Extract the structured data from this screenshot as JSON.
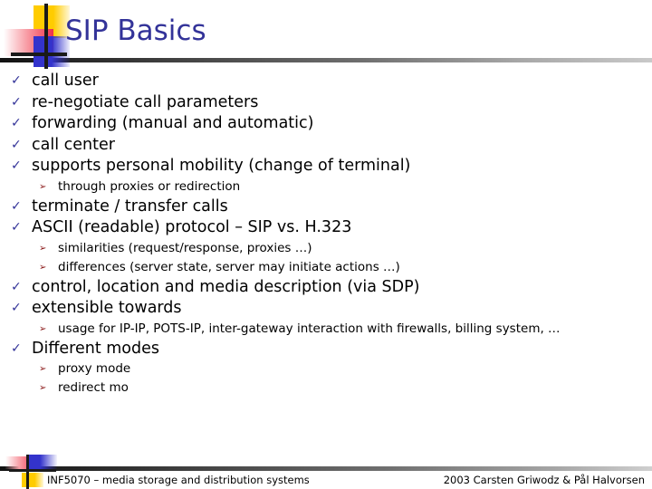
{
  "slide": {
    "title": "SIP Basics",
    "title_color": "#333399",
    "bullet_marker_level1": "✓",
    "bullet_marker_level1_name": "check-mark-icon",
    "bullet_marker_level1_color": "#333399",
    "bullet_marker_level2": "➢",
    "bullet_marker_level2_name": "arrowhead-bullet-icon",
    "bullet_marker_level2_color": "#8b1a1a",
    "items": [
      {
        "text": "call user",
        "subitems": []
      },
      {
        "text": "re-negotiate call parameters",
        "subitems": []
      },
      {
        "text": "forwarding (manual and automatic)",
        "subitems": []
      },
      {
        "text": "call center",
        "subitems": []
      },
      {
        "text": "supports personal mobility (change of terminal)",
        "subitems": [
          {
            "text": "through proxies or redirection"
          }
        ]
      },
      {
        "text": "terminate / transfer calls",
        "subitems": []
      },
      {
        "text": "ASCII (readable) protocol – SIP vs. H.323",
        "subitems": [
          {
            "text": "similarities (request/response, proxies …)"
          },
          {
            "text": "differences (server state, server may initiate actions …)"
          }
        ]
      },
      {
        "text": "control, location and media description (via SDP)",
        "subitems": []
      },
      {
        "text": "extensible towards",
        "subitems": [
          {
            "text": "usage for IP-IP, POTS-IP, inter-gateway interaction with firewalls, billing system, …"
          }
        ]
      },
      {
        "text": "Different modes",
        "subitems": [
          {
            "text": "proxy mode"
          },
          {
            "text": "redirect mo"
          }
        ]
      }
    ]
  },
  "footer": {
    "left": "INF5070 – media storage and distribution systems",
    "right": "2003  Carsten Griwodz & Pål Halvorsen"
  },
  "logo": {
    "yellow": "#ffcc00",
    "red": "#f0304a",
    "blue": "#3333cc",
    "line": "#1a1a1a"
  }
}
